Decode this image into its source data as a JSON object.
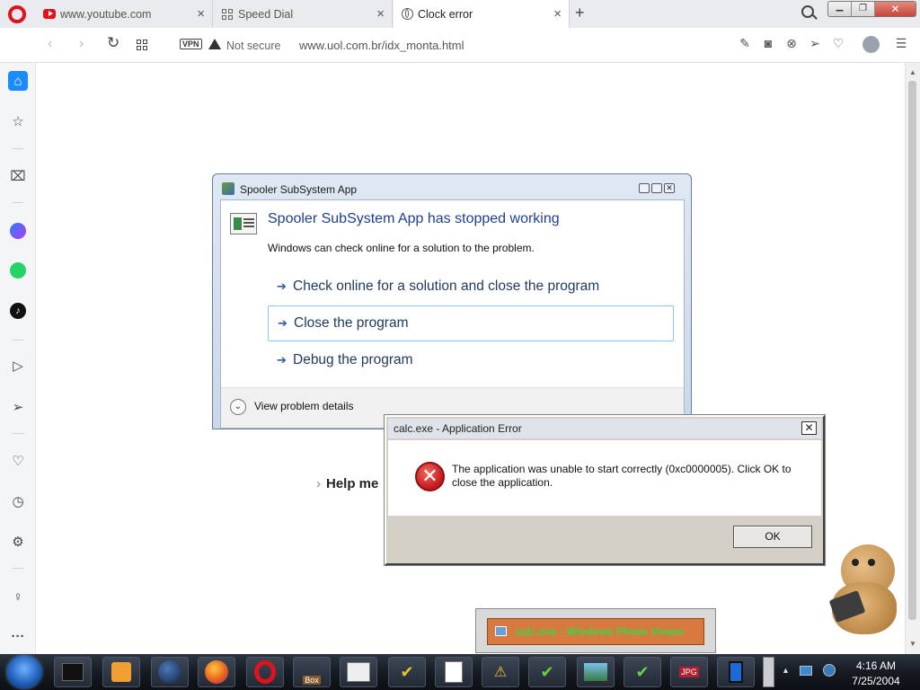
{
  "tabs": [
    {
      "title": "www.youtube.com",
      "icon": "youtube-icon"
    },
    {
      "title": "Speed Dial",
      "icon": "speed-dial-icon"
    },
    {
      "title": "Clock error",
      "icon": "globe-icon"
    }
  ],
  "address_bar": {
    "vpn_label": "VPN",
    "security_text": "Not secure",
    "url": "www.uol.com.br/idx_monta.html"
  },
  "sidebar": {
    "items": [
      "home-icon",
      "star-icon",
      "shopping-bag-icon",
      "messenger-icon",
      "whatsapp-icon",
      "tiktok-icon",
      "player-icon",
      "send-icon",
      "heart-icon",
      "history-icon",
      "settings-icon",
      "tips-icon",
      "more-icon"
    ]
  },
  "page": {
    "help_text": "Help me"
  },
  "spooler_dialog": {
    "title": "Spooler SubSystem App",
    "heading": "Spooler SubSystem App has stopped working",
    "subtext": "Windows can check online for a solution to the problem.",
    "options": [
      "Check online for a solution and close the program",
      "Close the program",
      "Debug the program"
    ],
    "details_label": "View problem details"
  },
  "calc_dialog": {
    "title": "calc.exe - Application Error",
    "message": "The application was unable to start correctly (0xc0000005). Click OK to close the application.",
    "ok_label": "OK"
  },
  "popup": {
    "text": "calc.exe - Windows Photo Viewer"
  },
  "taskbar": {
    "time": "4:16 AM",
    "date": "7/25/2004",
    "box_label": "Box",
    "jpg_label": "JPG"
  },
  "colors": {
    "accent": "#0a84ff",
    "opera_red": "#e0121b",
    "error_red": "#c4161c",
    "popup_bg": "#d87a40",
    "popup_text": "#3cd34a"
  }
}
